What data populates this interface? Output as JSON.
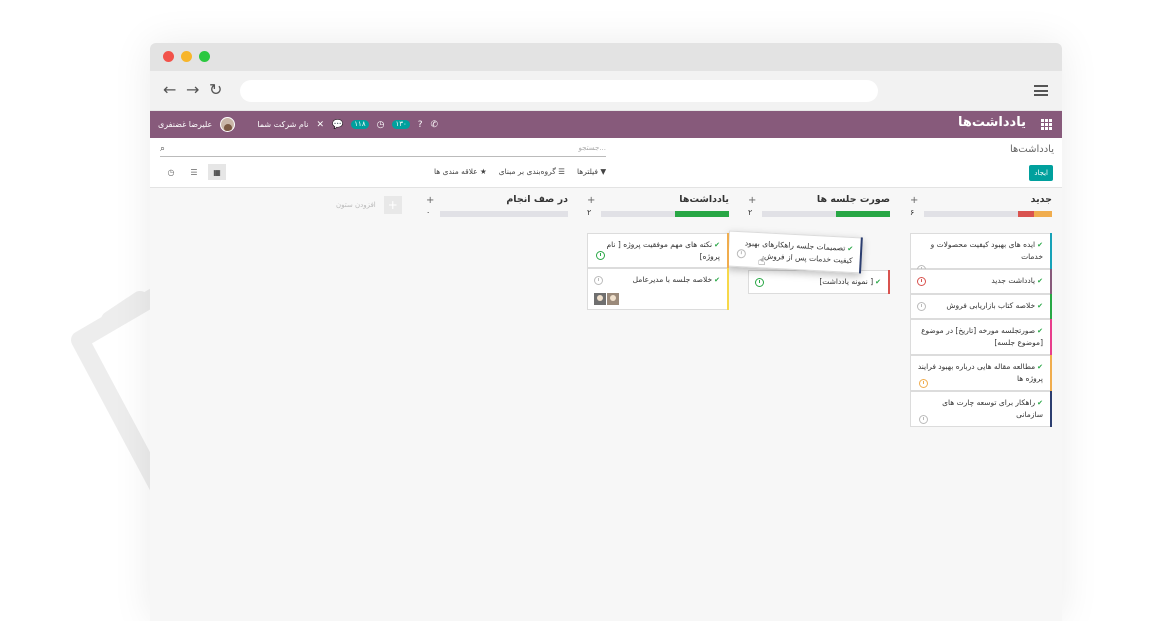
{
  "app": {
    "title": "یادداشت‌ها",
    "company": "نام شرکت شما",
    "user": "علیرضا غضنفری",
    "messages_count": "۱۱۸",
    "activities_count": "۱۳۰"
  },
  "control_panel": {
    "breadcrumb": "یادداشت‌ها",
    "search_placeholder": "جستجو...",
    "create_label": "ایجاد",
    "filters_label": "فیلترها",
    "groupby_label": "گروه‌بندی بر مبنای",
    "favorites_label": "علاقه مندی ها"
  },
  "kanban": {
    "add_column_label": "افزودن ستون",
    "columns": [
      {
        "title": "جدید",
        "count": "۶",
        "cards": [
          {
            "text": "ایده های بهبود کیفیت محصولات و خدمات"
          },
          {
            "text": "یادداشت جدید"
          },
          {
            "text": "خلاصه کتاب بازاریابی فروش"
          },
          {
            "text": "صورتجلسه مورخه [تاریخ] در موضوع [موضوع جلسه]"
          },
          {
            "text": "مطالعه مقاله هایی درباره بهبود فرایند پروژه ها"
          },
          {
            "text": "راهکار برای توسعه چارت های سازمانی"
          }
        ]
      },
      {
        "title": "صورت جلسه ها",
        "count": "۲",
        "cards": [
          {
            "text": "[ نمونه یادداشت]"
          },
          {
            "text": "تصمیمات جلسه راهکارهای بهبود کیفیت خدمات پس از فروش"
          }
        ]
      },
      {
        "title": "یادداشت‌ها",
        "count": "۲",
        "cards": [
          {
            "text": "نکته های مهم موفقیت پروژه [ نام پروژه]"
          },
          {
            "text": "خلاصه جلسه با مدیرعامل"
          }
        ]
      },
      {
        "title": "در صف انجام",
        "count": "۰",
        "cards": []
      }
    ]
  },
  "colors": {
    "brand": "#875a7b",
    "accent": "#00a09d",
    "success": "#28a745",
    "danger": "#d9534f",
    "warning": "#f0ad4e"
  }
}
